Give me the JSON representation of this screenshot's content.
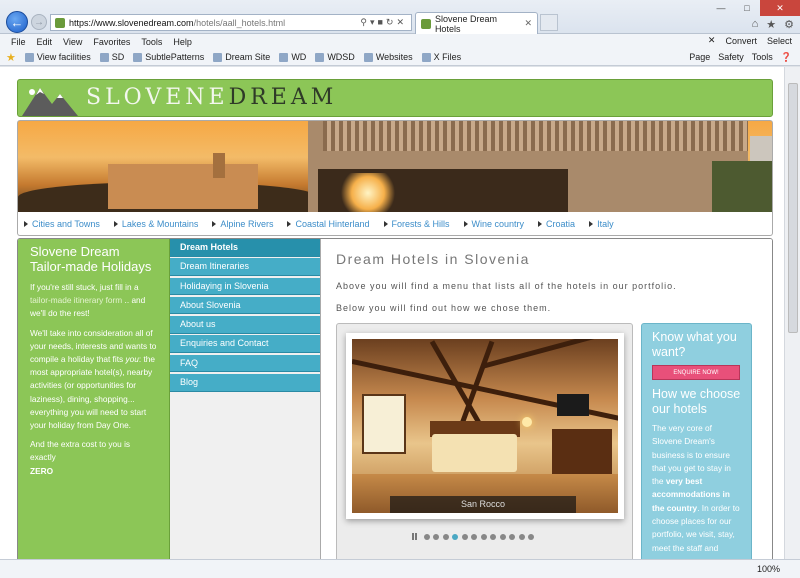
{
  "browser": {
    "url_host": "https://www.slovenedream.com",
    "url_path": "/hotels/aall_hotels.html",
    "tab_title": "Slovene Dream Hotels",
    "menu": [
      "File",
      "Edit",
      "View",
      "Favorites",
      "Tools",
      "Help"
    ],
    "toolbar_right": {
      "convert": "Convert",
      "select": "Select"
    },
    "favorites": [
      "View facilities",
      "SD",
      "SubtlePatterns",
      "Dream Site",
      "WD",
      "WDSD",
      "Websites",
      "X Files"
    ],
    "command_bar": {
      "page": "Page",
      "safety": "Safety",
      "tools": "Tools"
    },
    "zoom": "100%"
  },
  "site": {
    "logo_part1": "SLOVENE",
    "logo_part2": "DREAM",
    "regions": [
      "Cities and Towns",
      "Lakes & Mountains",
      "Alpine Rivers",
      "Coastal Hinterland",
      "Forests & Hills",
      "Wine country",
      "Croatia",
      "Italy"
    ],
    "left": {
      "heading": "Slovene Dream Tailor-made Holidays",
      "p1_a": "If you're still stuck, just fill in a ",
      "p1_link": "tailor-made itinerary form",
      "p1_b": " .. and we'll do the rest!",
      "p2_a": "We'll take into consideration all of your needs, interests and wants to compile a holiday that fits ",
      "p2_em": "you",
      "p2_b": ": the most appropriate hotel(s), nearby activities (or opportunities for laziness), dining, shopping... everything you will need to start your holiday from Day One.",
      "p3": "And the extra cost to you is exactly",
      "p3_bold": "ZERO"
    },
    "menu": [
      "Dream Hotels",
      "Dream Itineraries",
      "Holidaying in Slovenia",
      "About Slovenia",
      "About us",
      "Enquiries and Contact",
      "FAQ",
      "Blog"
    ],
    "title": "Dream Hotels in Slovenia",
    "intro1": "Above you will find a menu that lists all of the hotels in our portfolio.",
    "intro2": "Below you will find out how we chose them.",
    "gallery": {
      "caption": "San Rocco",
      "dot_count": 12,
      "active_dot": 3
    },
    "sidebox": {
      "heading1": "Know what you want?",
      "button": "ENQUIRE NOW!",
      "heading2": "How we choose our hotels",
      "p_a": "The very core of Slovene Dream's business is to ensure that you get to stay in the ",
      "p_bold": "very best accommodations in the country",
      "p_b": ". In order to choose places for our portfolio, we visit, stay, meet the staff and"
    }
  },
  "colors": {
    "green": "#8cc657",
    "teal": "#45adc7",
    "pink": "#e8507a",
    "link": "#3c8dc9"
  }
}
